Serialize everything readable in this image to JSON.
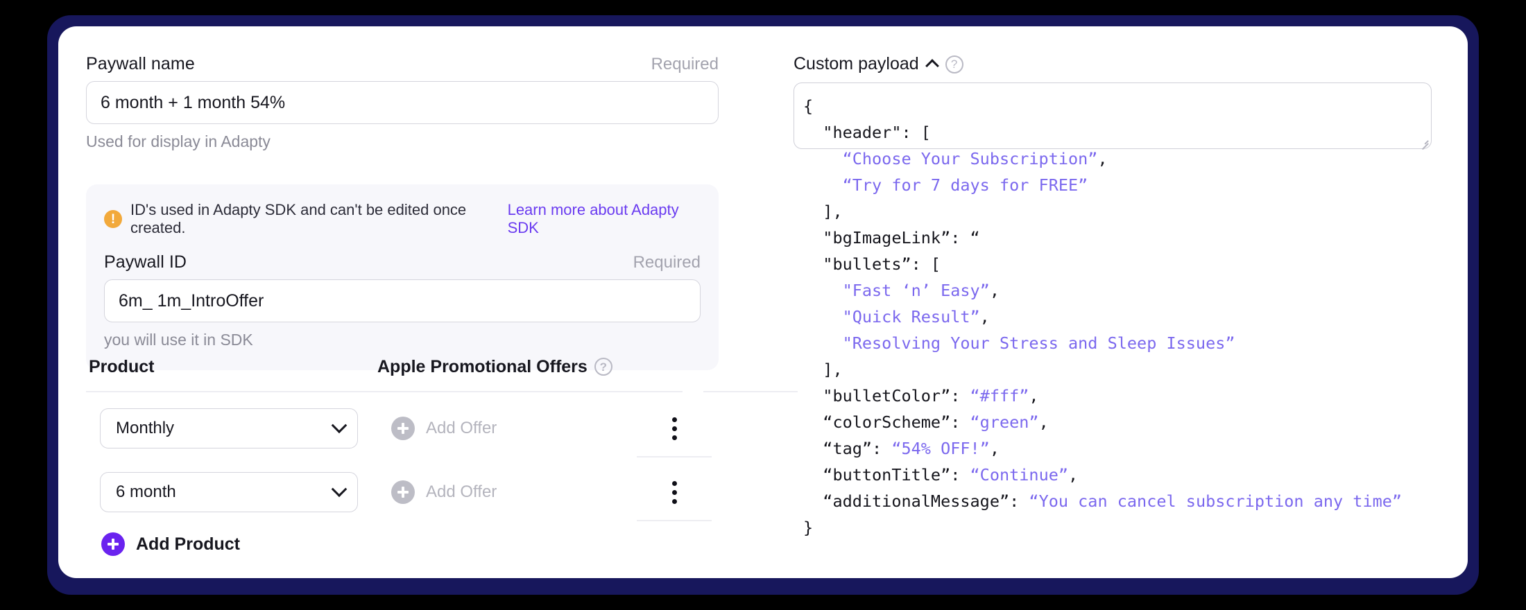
{
  "window": {
    "background_color": "#000000",
    "frame_color": "#17175c",
    "card_color": "#ffffff"
  },
  "form": {
    "paywall_name": {
      "label": "Paywall name",
      "required_tag": "Required",
      "value": "6 month + 1 month 54%",
      "helper": "Used for display in Adapty"
    },
    "sdk_note": {
      "text": "ID's used in Adapty SDK and can't be edited once created.",
      "link_label": "Learn more about Adapty SDK",
      "link_color": "#6a3bf0",
      "icon": "warning-icon"
    },
    "paywall_id": {
      "label": "Paywall ID",
      "required_tag": "Required",
      "value": "6m_ 1m_IntroOffer",
      "helper": "you will use it in SDK"
    }
  },
  "products": {
    "column_product": "Product",
    "column_offers": "Apple Promotional Offers",
    "offers_help_icon": "question-circle-icon",
    "rows": [
      {
        "product": "Monthly",
        "offer_placeholder": "Add Offer"
      },
      {
        "product": "6 month",
        "offer_placeholder": "Add Offer"
      }
    ],
    "add_product_label": "Add Product",
    "add_product_color": "#6a23ef"
  },
  "custom_payload": {
    "title": "Custom payload",
    "collapse_icon": "chevron-up-icon",
    "help_icon": "question-circle-icon",
    "string_color": "#7b68ee",
    "lines": [
      {
        "indent": 0,
        "parts": [
          {
            "t": "{",
            "c": "plain"
          }
        ]
      },
      {
        "indent": 1,
        "parts": [
          {
            "t": "\"header\": [",
            "c": "plain"
          }
        ]
      },
      {
        "indent": 2,
        "parts": [
          {
            "t": "“Choose Your Subscription”",
            "c": "str"
          },
          {
            "t": ",",
            "c": "plain"
          }
        ]
      },
      {
        "indent": 2,
        "parts": [
          {
            "t": "“Try for 7 days for FREE”",
            "c": "str"
          }
        ]
      },
      {
        "indent": 1,
        "parts": [
          {
            "t": "],",
            "c": "plain"
          }
        ]
      },
      {
        "indent": 1,
        "parts": [
          {
            "t": "\"bgImageLink”: “",
            "c": "plain"
          }
        ]
      },
      {
        "indent": 1,
        "parts": [
          {
            "t": "\"bullets”: [",
            "c": "plain"
          }
        ]
      },
      {
        "indent": 2,
        "parts": [
          {
            "t": "\"Fast ‘n’ Easy”",
            "c": "str"
          },
          {
            "t": ",",
            "c": "plain"
          }
        ]
      },
      {
        "indent": 2,
        "parts": [
          {
            "t": "\"Quick Result”",
            "c": "str"
          },
          {
            "t": ",",
            "c": "plain"
          }
        ]
      },
      {
        "indent": 2,
        "parts": [
          {
            "t": "\"Resolving Your Stress and Sleep Issues”",
            "c": "str"
          }
        ]
      },
      {
        "indent": 1,
        "parts": [
          {
            "t": "],",
            "c": "plain"
          }
        ]
      },
      {
        "indent": 1,
        "parts": [
          {
            "t": "\"bulletColor”: ",
            "c": "plain"
          },
          {
            "t": "“#fff”",
            "c": "str"
          },
          {
            "t": ",",
            "c": "plain"
          }
        ]
      },
      {
        "indent": 1,
        "parts": [
          {
            "t": "“colorScheme”: ",
            "c": "plain"
          },
          {
            "t": "“green”",
            "c": "str"
          },
          {
            "t": ",",
            "c": "plain"
          }
        ]
      },
      {
        "indent": 1,
        "parts": [
          {
            "t": "“tag”: ",
            "c": "plain"
          },
          {
            "t": "“54% OFF!”",
            "c": "str"
          },
          {
            "t": ",",
            "c": "plain"
          }
        ]
      },
      {
        "indent": 1,
        "parts": [
          {
            "t": "“buttonTitle”: ",
            "c": "plain"
          },
          {
            "t": "“Continue”",
            "c": "str"
          },
          {
            "t": ",",
            "c": "plain"
          }
        ]
      },
      {
        "indent": 1,
        "parts": [
          {
            "t": "“additionalMessage”: ",
            "c": "plain"
          },
          {
            "t": "“You can cancel subscription any time”",
            "c": "str"
          }
        ]
      },
      {
        "indent": 0,
        "parts": [
          {
            "t": "}",
            "c": "plain"
          }
        ]
      }
    ]
  }
}
